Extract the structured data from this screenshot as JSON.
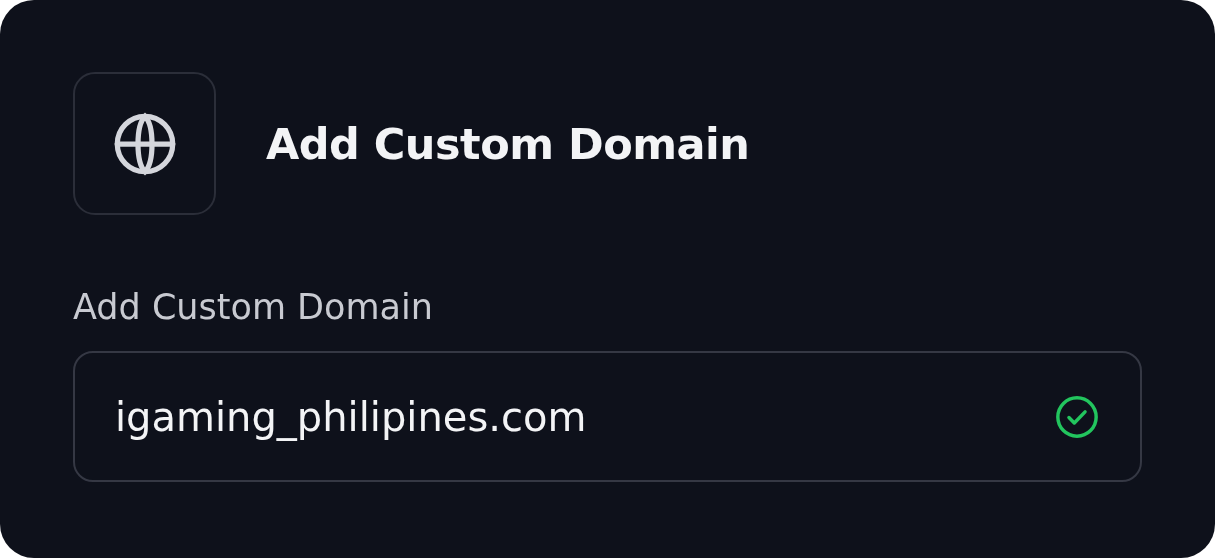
{
  "dialog": {
    "title": "Add Custom Domain"
  },
  "field": {
    "label": "Add Custom Domain",
    "value": "igaming_philipines.com",
    "valid": true
  }
}
